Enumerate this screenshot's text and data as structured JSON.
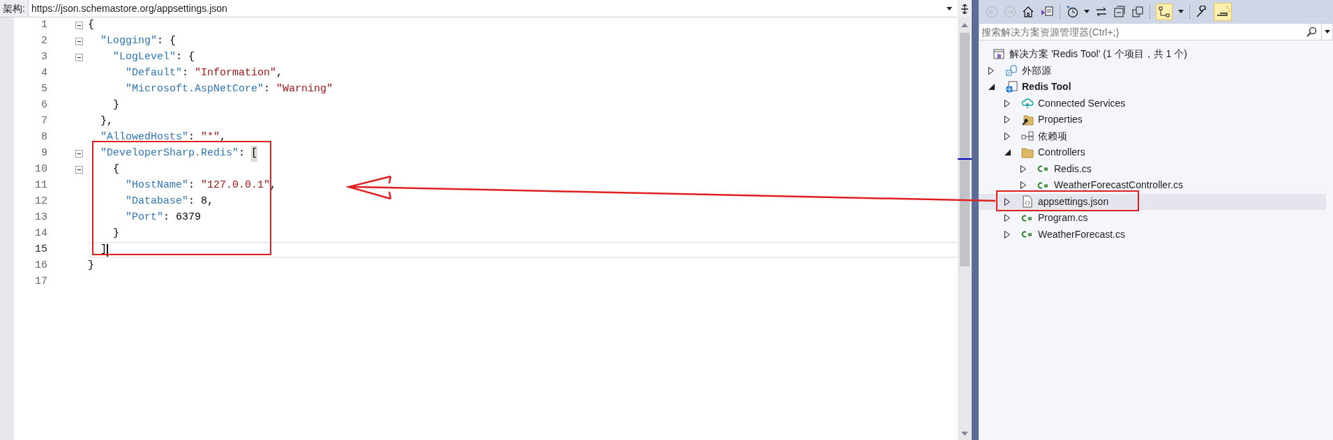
{
  "editor": {
    "schema_label": "架构:",
    "schema_url": "https://json.schemastore.org/appsettings.json",
    "lines": [
      {
        "number": "1",
        "foldable": true,
        "current": false,
        "tokens": [
          {
            "kind": "punct",
            "text": "{"
          }
        ]
      },
      {
        "number": "2",
        "foldable": true,
        "current": false,
        "tokens": [
          {
            "kind": "key",
            "text": "  \"Logging\""
          },
          {
            "kind": "punct",
            "text": ": {"
          }
        ]
      },
      {
        "number": "3",
        "foldable": true,
        "current": false,
        "tokens": [
          {
            "kind": "key",
            "text": "    \"LogLevel\""
          },
          {
            "kind": "punct",
            "text": ": {"
          }
        ]
      },
      {
        "number": "4",
        "foldable": false,
        "current": false,
        "tokens": [
          {
            "kind": "key",
            "text": "      \"Default\""
          },
          {
            "kind": "punct",
            "text": ": "
          },
          {
            "kind": "string",
            "text": "\"Information\""
          },
          {
            "kind": "punct",
            "text": ","
          }
        ]
      },
      {
        "number": "5",
        "foldable": false,
        "current": false,
        "tokens": [
          {
            "kind": "key",
            "text": "      \"Microsoft.AspNetCore\""
          },
          {
            "kind": "punct",
            "text": ": "
          },
          {
            "kind": "string",
            "text": "\"Warning\""
          }
        ]
      },
      {
        "number": "6",
        "foldable": false,
        "current": false,
        "tokens": [
          {
            "kind": "punct",
            "text": "    }"
          }
        ]
      },
      {
        "number": "7",
        "foldable": false,
        "current": false,
        "tokens": [
          {
            "kind": "punct",
            "text": "  },"
          }
        ]
      },
      {
        "number": "8",
        "foldable": false,
        "current": false,
        "tokens": [
          {
            "kind": "key",
            "text": "  \"AllowedHosts\""
          },
          {
            "kind": "punct",
            "text": ": "
          },
          {
            "kind": "string",
            "text": "\"*\""
          },
          {
            "kind": "punct",
            "text": ","
          }
        ]
      },
      {
        "number": "9",
        "foldable": true,
        "current": false,
        "tokens": [
          {
            "kind": "key",
            "text": "  \"DeveloperSharp.Redis\""
          },
          {
            "kind": "punct",
            "text": ": "
          },
          {
            "kind": "match",
            "text": "["
          }
        ]
      },
      {
        "number": "10",
        "foldable": true,
        "current": false,
        "tokens": [
          {
            "kind": "punct",
            "text": "    {"
          }
        ]
      },
      {
        "number": "11",
        "foldable": false,
        "current": false,
        "tokens": [
          {
            "kind": "key",
            "text": "      \"HostName\""
          },
          {
            "kind": "punct",
            "text": ": "
          },
          {
            "kind": "string",
            "text": "\"127.0.0.1\""
          },
          {
            "kind": "punct",
            "text": ","
          }
        ]
      },
      {
        "number": "12",
        "foldable": false,
        "current": false,
        "tokens": [
          {
            "kind": "key",
            "text": "      \"Database\""
          },
          {
            "kind": "punct",
            "text": ": 8,"
          }
        ]
      },
      {
        "number": "13",
        "foldable": false,
        "current": false,
        "tokens": [
          {
            "kind": "key",
            "text": "      \"Port\""
          },
          {
            "kind": "punct",
            "text": ": 6379"
          }
        ]
      },
      {
        "number": "14",
        "foldable": false,
        "current": false,
        "tokens": [
          {
            "kind": "punct",
            "text": "    }"
          }
        ]
      },
      {
        "number": "15",
        "foldable": false,
        "current": true,
        "tokens": [
          {
            "kind": "punct",
            "text": "  ]"
          }
        ]
      },
      {
        "number": "16",
        "foldable": false,
        "current": false,
        "tokens": [
          {
            "kind": "punct",
            "text": "}"
          }
        ]
      },
      {
        "number": "17",
        "foldable": false,
        "current": false
      }
    ]
  },
  "solution_explorer": {
    "search": {
      "placeholder": "搜索解决方案资源管理器(Ctrl+;)"
    },
    "tree": {
      "kind": "solution",
      "label": "解决方案 'Redis Tool' (1 个项目，共 1 个)",
      "selected": false,
      "children": [
        {
          "kind": "external",
          "label": "外部源",
          "expanded": false,
          "selected": false
        },
        {
          "kind": "project",
          "label": "Redis Tool",
          "expanded": true,
          "selected": false,
          "children": [
            {
              "kind": "connected",
              "label": "Connected Services",
              "expanded": false,
              "selected": false
            },
            {
              "kind": "properties",
              "label": "Properties",
              "expanded": false,
              "selected": false
            },
            {
              "kind": "dependencies",
              "label": "依赖项",
              "expanded": false,
              "selected": false
            },
            {
              "kind": "folder",
              "label": "Controllers",
              "expanded": true,
              "selected": false,
              "children": [
                {
                  "kind": "csharp",
                  "label": "Redis.cs",
                  "expanded": false,
                  "selected": false
                },
                {
                  "kind": "csharp",
                  "label": "WeatherForecastController.cs",
                  "expanded": false,
                  "selected": false
                }
              ]
            },
            {
              "kind": "json",
              "label": "appsettings.json",
              "expanded": false,
              "selected": true
            },
            {
              "kind": "csharp",
              "label": "Program.cs",
              "expanded": false,
              "selected": false
            },
            {
              "kind": "csharp",
              "label": "WeatherForecast.cs",
              "expanded": false,
              "selected": false
            }
          ]
        }
      ]
    }
  }
}
